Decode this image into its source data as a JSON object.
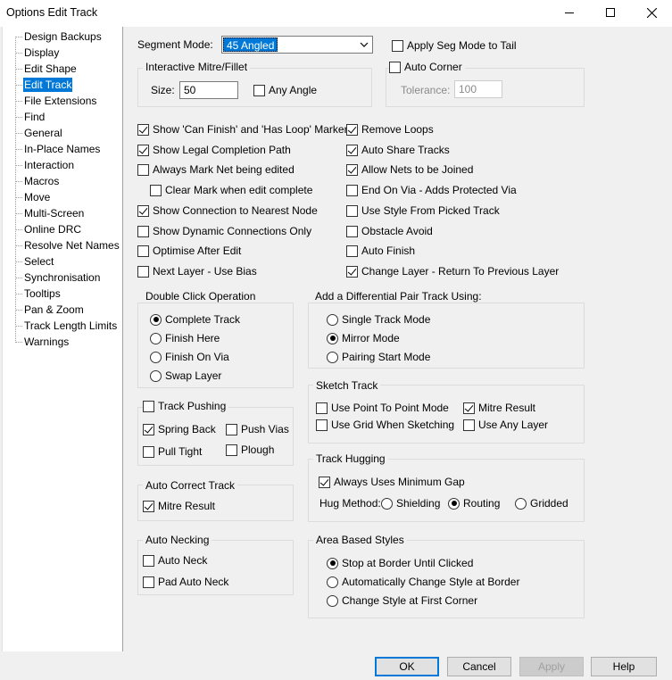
{
  "window": {
    "title": "Options  Edit Track"
  },
  "tree": {
    "items": [
      "Design Backups",
      "Display",
      "Edit Shape",
      "Edit Track",
      "File Extensions",
      "Find",
      "General",
      "In-Place Names",
      "Interaction",
      "Macros",
      "Move",
      "Multi-Screen",
      "Online DRC",
      "Resolve Net Names",
      "Select",
      "Synchronisation",
      "Tooltips",
      "Pan & Zoom",
      "Track Length Limits",
      "Warnings"
    ],
    "selected": "Edit Track"
  },
  "segment_mode": {
    "label": "Segment Mode:",
    "value": "45 Angled"
  },
  "apply_seg_mode_tail": {
    "label": "Apply Seg Mode to Tail",
    "checked": false
  },
  "interactive_mitre": {
    "title": "Interactive Mitre/Fillet",
    "size_label": "Size:",
    "size_value": "50",
    "any_angle": {
      "label": "Any Angle",
      "checked": false
    }
  },
  "auto_corner": {
    "label": "Auto Corner",
    "checked": false,
    "tolerance_label": "Tolerance:",
    "tolerance_value": "100"
  },
  "left_options": [
    {
      "label": "Show 'Can Finish' and 'Has Loop' Markers",
      "checked": true
    },
    {
      "label": "Show Legal Completion Path",
      "checked": true
    },
    {
      "label": "Always Mark Net being edited",
      "checked": false
    },
    {
      "label": "Clear Mark when edit complete",
      "checked": false
    },
    {
      "label": "Show Connection to Nearest Node",
      "checked": true
    },
    {
      "label": "Show Dynamic Connections Only",
      "checked": false
    },
    {
      "label": "Optimise After Edit",
      "checked": false
    },
    {
      "label": "Next Layer - Use Bias",
      "checked": false
    }
  ],
  "right_options": [
    {
      "label": "Remove Loops",
      "checked": true
    },
    {
      "label": "Auto Share Tracks",
      "checked": true
    },
    {
      "label": "Allow Nets to be Joined",
      "checked": true
    },
    {
      "label": "End On Via - Adds Protected Via",
      "checked": false
    },
    {
      "label": "Use Style From Picked Track",
      "checked": false
    },
    {
      "label": "Obstacle Avoid",
      "checked": false
    },
    {
      "label": "Auto Finish",
      "checked": false
    },
    {
      "label": "Change Layer - Return To Previous Layer",
      "checked": true
    }
  ],
  "double_click": {
    "title": "Double Click Operation",
    "options": [
      "Complete Track",
      "Finish Here",
      "Finish On Via",
      "Swap Layer"
    ],
    "selected": 0
  },
  "diff_pair": {
    "title": "Add a Differential Pair Track Using:",
    "options": [
      "Single Track Mode",
      "Mirror Mode",
      "Pairing Start Mode"
    ],
    "selected": 1
  },
  "track_pushing": {
    "title": "Track Pushing",
    "checked": false,
    "spring_back": {
      "label": "Spring Back",
      "checked": true
    },
    "push_vias": {
      "label": "Push Vias",
      "checked": false
    },
    "pull_tight": {
      "label": "Pull Tight",
      "checked": false
    },
    "plough": {
      "label": "Plough",
      "checked": false
    }
  },
  "sketch_track": {
    "title": "Sketch Track",
    "point_to_point": {
      "label": "Use Point To Point Mode",
      "checked": false
    },
    "mitre_result": {
      "label": "Mitre Result",
      "checked": true
    },
    "use_grid": {
      "label": "Use Grid When Sketching",
      "checked": false
    },
    "any_layer": {
      "label": "Use Any Layer",
      "checked": false
    }
  },
  "auto_correct": {
    "title": "Auto Correct Track",
    "mitre_result": {
      "label": "Mitre Result",
      "checked": true
    }
  },
  "track_hugging": {
    "title": "Track Hugging",
    "min_gap": {
      "label": "Always Uses Minimum Gap",
      "checked": true
    },
    "method_label": "Hug Method:",
    "methods": [
      "Shielding",
      "Routing",
      "Gridded"
    ],
    "selected": 1
  },
  "auto_necking": {
    "title": "Auto Necking",
    "auto_neck": {
      "label": "Auto Neck",
      "checked": false
    },
    "pad_auto_neck": {
      "label": "Pad Auto Neck",
      "checked": false
    }
  },
  "area_styles": {
    "title": "Area Based Styles",
    "options": [
      "Stop at Border Until Clicked",
      "Automatically Change Style at Border",
      "Change Style at First Corner"
    ],
    "selected": 0
  },
  "buttons": {
    "ok": "OK",
    "cancel": "Cancel",
    "apply": "Apply",
    "help": "Help"
  }
}
